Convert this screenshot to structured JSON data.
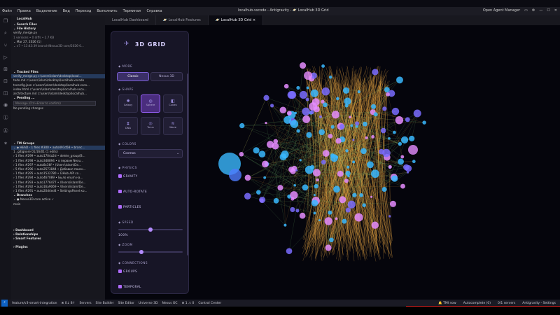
{
  "titlebar": {
    "menu": [
      "Файл",
      "Правка",
      "Выделение",
      "Вид",
      "Переход",
      "Выполнить",
      "Терминал",
      "Справка"
    ],
    "title": "localhub-vscode - Antigravity - 🪐 LocalHub 3D Grid",
    "open_agent_manager": "Open Agent Manager"
  },
  "sidebar": {
    "title": "LocalHub",
    "rows": [
      {
        "t": "⌄ Search Files",
        "k": "h"
      },
      {
        "t": "⌄ File History",
        "k": "h"
      },
      {
        "t": "   verify_merge.py",
        "k": ""
      },
      {
        "t": "   1 versions • 0 diffs • 2.7 KB",
        "k": "dim"
      },
      {
        "t": " ⌄ Mar 27, 2026 (1)",
        "k": ""
      },
      {
        "t": "    ⌄ v7 • 13:43:39  branch/Nexus3D-core/2026-0...",
        "k": "dim"
      },
      {
        "t": "",
        "k": ""
      },
      {
        "t": "",
        "k": ""
      },
      {
        "t": "",
        "k": ""
      },
      {
        "t": "",
        "k": ""
      },
      {
        "t": "",
        "k": ""
      },
      {
        "t": "⌄ Tracked Files",
        "k": "h"
      },
      {
        "t": "  verify_merge.py  c:\\users\\islam\\desktop\\local...",
        "k": "sel"
      },
      {
        "t": "  todo.md  c:\\users\\islam\\desktop\\localhub-vscode",
        "k": ""
      },
      {
        "t": "  tsconfig.json  c:\\users\\islam\\desktop\\localhub-vsco...",
        "k": ""
      },
      {
        "t": "  index.html  c:\\users\\islam\\desktop\\localhub-vsco...",
        "k": ""
      },
      {
        "t": "  architecture.md  c:\\users\\islam\\desktop\\localhub...",
        "k": ""
      },
      {
        "t": "⌄ Pending ...",
        "k": "h"
      }
    ],
    "message_placeholder": "Message (Ctrl+Enter to confirm)",
    "rows2": [
      {
        "t": "   No pending changes",
        "k": ""
      },
      {
        "t": "",
        "k": ""
      },
      {
        "t": "",
        "k": ""
      },
      {
        "t": "",
        "k": ""
      },
      {
        "t": "",
        "k": ""
      },
      {
        "t": "",
        "k": ""
      },
      {
        "t": "",
        "k": ""
      },
      {
        "t": "",
        "k": ""
      },
      {
        "t": "⌄ TM Groups",
        "k": "h"
      },
      {
        "t": "  ⌄ ◆ HEAD - 1 files  #300 • auto491d58 • branc...",
        "k": "sel"
      },
      {
        "t": "      1  _gitignore  01/16/01 (1 edits)",
        "k": ""
      },
      {
        "t": "  › 1 files  #299 • auto1704a2d • delete_group(B...",
        "k": ""
      },
      {
        "t": "  › 1 files  #298 • auto348894 • в первом Nexu...",
        "k": ""
      },
      {
        "t": "  › 1 files  #297 • auto8c36f • (Users\\islam\\De...",
        "k": ""
      },
      {
        "t": "  › 5 files  #296 • auto2573844 • Добавил поиск...",
        "k": ""
      },
      {
        "t": "  › 1 files  #295 • auto1532780 • I3Hub API со...",
        "k": ""
      },
      {
        "t": "  › 1 files  #294 • auto467089 • Было enum на...",
        "k": ""
      },
      {
        "t": "  › 1 files  #293 • auto1776477 • /Users/islam/De...",
        "k": ""
      },
      {
        "t": "  › 1 files  #292 • auto16a9069 • /Users/islam/De...",
        "k": ""
      },
      {
        "t": "  › 1 files  #291 • auto20d4ed4 • SettingsPanel ко...",
        "k": ""
      },
      {
        "t": "⌄ Branches",
        "k": "h"
      },
      {
        "t": "  ⌄ ● Nexus3D-core  active  ✓",
        "k": ""
      },
      {
        "t": "      main",
        "k": ""
      },
      {
        "t": "",
        "k": ""
      },
      {
        "t": "",
        "k": ""
      },
      {
        "t": "",
        "k": ""
      },
      {
        "t": "",
        "k": ""
      },
      {
        "t": "",
        "k": ""
      },
      {
        "t": "› Dashboard",
        "k": "h"
      },
      {
        "t": "› Relationships",
        "k": "h"
      },
      {
        "t": "› Smart Features",
        "k": "h"
      },
      {
        "t": "",
        "k": ""
      },
      {
        "t": "› Plugins",
        "k": "h"
      }
    ]
  },
  "tabs": [
    {
      "label": "LocalHub Dashboard",
      "active": false
    },
    {
      "label": "🪐 LocalHub Features",
      "active": false
    },
    {
      "label": "🪐 LocalHub 3D Grid",
      "active": true
    }
  ],
  "panel": {
    "title": "3D GRID",
    "mode_label": "◆ MODE",
    "mode_classic": "Classic",
    "mode_nexus": "Nexus 3D",
    "shape_label": "◆ SHAPE",
    "shapes": [
      "Galaxy",
      "Sphere",
      "Cubes",
      "DNA",
      "Torus",
      "Wave"
    ],
    "colors_label": "◆ COLORS",
    "colors_value": "Cosmos",
    "physics_label": "◆ PHYSICS",
    "gravity": "GRAVITY",
    "auto_rotate": "AUTO-ROTATE",
    "particles": "PARTICLES",
    "speed_label": "◆ SPEED",
    "speed_value": "100%",
    "speed_level": 0.5,
    "zoom_label": "◆ ZOOM",
    "zoom_level": 0.35,
    "connections_label": "◆ CONNECTIONS",
    "groups": "GROUPS",
    "temporal": "TEMPORAL"
  },
  "statusbar": {
    "remote": "⚡",
    "left": [
      "feature/v3-smart-integration",
      "⊗ 0↓ 8↑",
      "Servers",
      "Site Builder",
      "Site Editor",
      "Universe 3D",
      "Nexus OC",
      "⊗ 1  ⚠ 0",
      "Control Center"
    ],
    "right": [
      "🔔 TMI now",
      "Autocomplete (0)",
      "0/1 servers",
      "Antigravity - Settings"
    ]
  },
  "colors": {
    "accent": "#9b62ff",
    "node_blue": "#39b8ff",
    "node_pink": "#e58cff",
    "edge_orange": "#e0a040",
    "edge_green": "#7fd07a"
  }
}
